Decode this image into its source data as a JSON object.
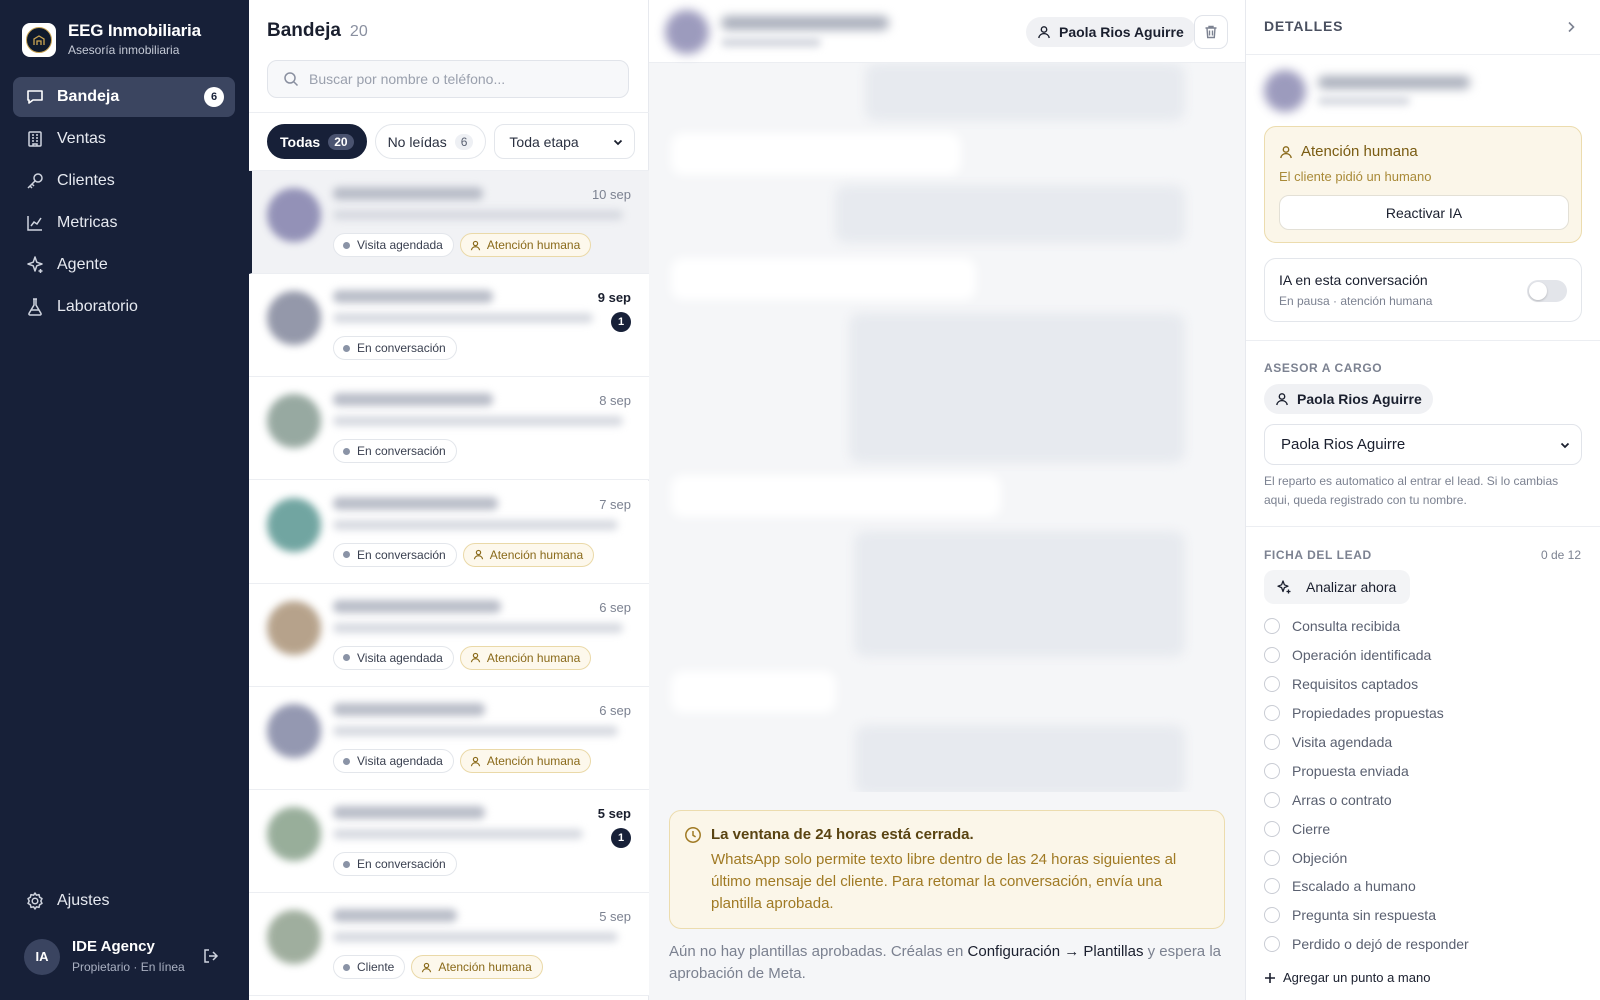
{
  "sidebar": {
    "brand": {
      "name": "EEG Inmobiliaria",
      "subtitle": "Asesoría inmobiliaria"
    },
    "items": [
      {
        "label": "Bandeja",
        "icon": "chat-bubble-icon",
        "badge": "6",
        "active": true
      },
      {
        "label": "Ventas",
        "icon": "building-icon"
      },
      {
        "label": "Clientes",
        "icon": "key-icon"
      },
      {
        "label": "Metricas",
        "icon": "chart-line-icon"
      },
      {
        "label": "Agente",
        "icon": "sparkle-icon"
      },
      {
        "label": "Laboratorio",
        "icon": "flask-icon"
      }
    ],
    "settings_label": "Ajustes",
    "user": {
      "initials": "IA",
      "name": "IDE Agency",
      "role": "Propietario · En línea"
    }
  },
  "inbox": {
    "title": "Bandeja",
    "count": "20",
    "search_placeholder": "Buscar por nombre o teléfono...",
    "filters": [
      {
        "label": "Todas",
        "count": "20",
        "active": true
      },
      {
        "label": "No leídas",
        "count": "6",
        "active": false
      }
    ],
    "stage_select": "Toda etapa",
    "conversations": [
      {
        "date": "10 sep",
        "unread": "",
        "tags": [
          "Visita agendada",
          "Atención humana"
        ],
        "avatar_color": "#7c7aa8",
        "selected": true
      },
      {
        "date": "9 sep",
        "unread": "1",
        "tags": [
          "En conversación"
        ],
        "avatar_color": "#7a7f95",
        "selected": false
      },
      {
        "date": "8 sep",
        "unread": "",
        "tags": [
          "En conversación"
        ],
        "avatar_color": "#7e948a",
        "selected": false
      },
      {
        "date": "7 sep",
        "unread": "",
        "tags": [
          "En conversación",
          "Atención humana"
        ],
        "avatar_color": "#4e8f8a",
        "selected": false
      },
      {
        "date": "6 sep",
        "unread": "",
        "tags": [
          "Visita agendada",
          "Atención humana"
        ],
        "avatar_color": "#a58c6f",
        "selected": false
      },
      {
        "date": "6 sep",
        "unread": "",
        "tags": [
          "Visita agendada",
          "Atención humana"
        ],
        "avatar_color": "#7a7f9e",
        "selected": false
      },
      {
        "date": "5 sep",
        "unread": "1",
        "tags": [
          "En conversación"
        ],
        "avatar_color": "#7f9a82",
        "selected": false
      },
      {
        "date": "5 sep",
        "unread": "",
        "tags": [
          "Cliente",
          "Atención humana"
        ],
        "avatar_color": "#889a86",
        "selected": false
      }
    ]
  },
  "chat": {
    "assignee": "Paola Rios Aguirre",
    "window_notice": {
      "title": "La ventana de 24 horas está cerrada.",
      "body": "WhatsApp solo permite texto libre dentro de las 24 horas siguientes al último mensaje del cliente. Para retomar la conversación, envía una plantilla aprobada."
    },
    "no_templates": {
      "before": "Aún no hay plantillas aprobadas. Créalas en ",
      "link": "Configuración → Plantillas",
      "after": " y espera la aprobación de Meta."
    }
  },
  "details": {
    "header": "DETALLES",
    "human_attention": {
      "title": "Atención humana",
      "subtitle": "El cliente pidió un humano",
      "button": "Reactivar IA"
    },
    "ai_toggle": {
      "title": "IA en esta conversación",
      "subtitle": "En pausa · atención humana",
      "enabled": false
    },
    "advisor": {
      "label": "ASESOR A CARGO",
      "current": "Paola Rios Aguirre",
      "select_value": "Paola Rios Aguirre",
      "note": "El reparto es automatico al entrar el lead. Si lo cambias aqui, queda registrado con tu nombre."
    },
    "lead_sheet": {
      "label": "FICHA DEL LEAD",
      "progress": "0 de 12",
      "analyze_button": "Analizar ahora",
      "checklist": [
        "Consulta recibida",
        "Operación identificada",
        "Requisitos captados",
        "Propiedades propuestas",
        "Visita agendada",
        "Propuesta enviada",
        "Arras o contrato",
        "Cierre",
        "Objeción",
        "Escalado a humano",
        "Pregunta sin respuesta",
        "Perdido o dejó de responder"
      ],
      "add_point": "Agregar un punto a mano"
    }
  }
}
